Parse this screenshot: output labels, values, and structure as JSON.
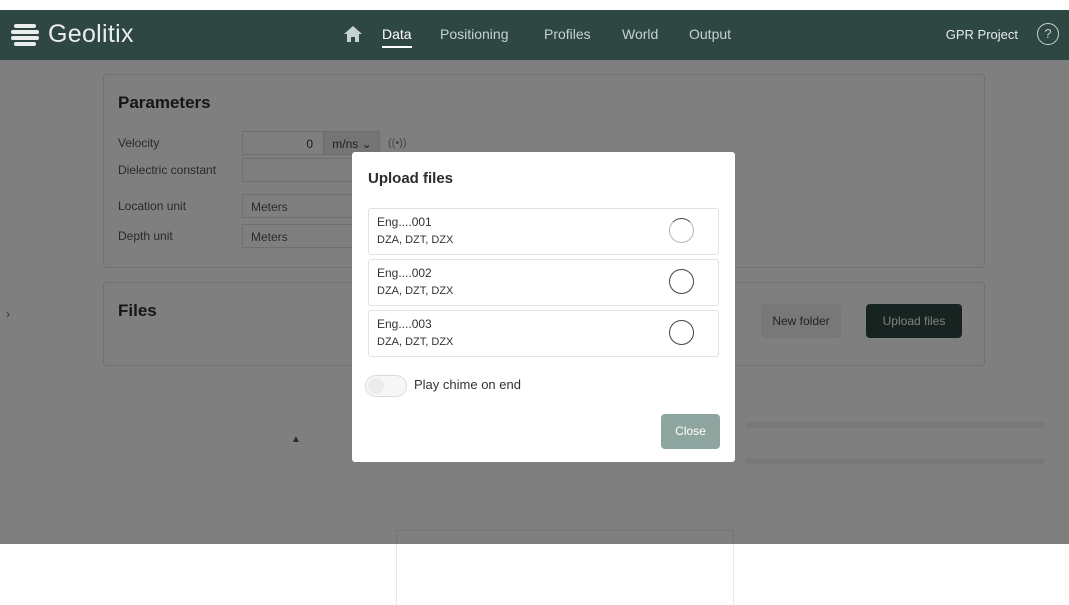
{
  "nav": {
    "brand": "Geolitix",
    "links": [
      "Data",
      "Positioning",
      "Profiles",
      "World",
      "Output"
    ],
    "project": "GPR Project"
  },
  "parameters": {
    "title": "Parameters",
    "velocity_label": "Velocity",
    "velocity_value": "0",
    "velocity_unit": "m/ns ⌄",
    "velocity_icon": "((•))",
    "dielectric_label": "Dielectric constant",
    "location_label": "Location unit",
    "location_value": "Meters",
    "depth_label": "Depth unit",
    "depth_value": "Meters"
  },
  "files": {
    "title": "Files",
    "new_folder": "New folder",
    "upload_files": "Upload files"
  },
  "modal": {
    "title": "Upload files",
    "items": [
      {
        "name": "Eng....001",
        "types": "DZA, DZT, DZX"
      },
      {
        "name": "Eng....002",
        "types": "DZA, DZT, DZX"
      },
      {
        "name": "Eng....003",
        "types": "DZA, DZT, DZX"
      }
    ],
    "chime_label": "Play chime on end",
    "close_label": "Close"
  },
  "colors": {
    "nav_bg": "#2f4743",
    "primary_button": "#2f4743",
    "close_button_disabled": "#8fa59f"
  }
}
